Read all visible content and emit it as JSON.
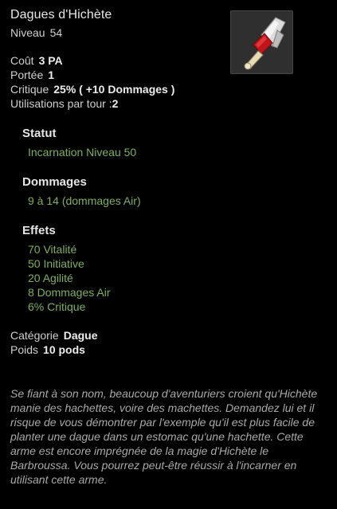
{
  "item": {
    "name": "Dagues d'Hichète",
    "level_label": "Niveau",
    "level_value": "54",
    "icon": "dagger-icon"
  },
  "stats": {
    "cost_label": "Coût",
    "cost_value": "3 PA",
    "range_label": "Portée",
    "range_value": "1",
    "critical_label": "Critique",
    "critical_value": "25% ( +10 Dommages )",
    "uses_label": "Utilisations par tour :",
    "uses_value": "2"
  },
  "sections": {
    "status": {
      "heading": "Statut",
      "lines": [
        "Incarnation Niveau 50"
      ]
    },
    "damage": {
      "heading": "Dommages",
      "lines": [
        "9 à 14 (dommages Air)"
      ]
    },
    "effects": {
      "heading": "Effets",
      "lines": [
        "70 Vitalité",
        "50 Initiative",
        "20 Agilité",
        "8 Dommages Air",
        "6% Critique"
      ]
    }
  },
  "meta": {
    "category_label": "Catégorie",
    "category_value": "Dague",
    "weight_label": "Poids",
    "weight_value": "10 pods"
  },
  "description": "Se fiant à son nom, beaucoup d'aventuriers croient qu'Hichète manie des hachettes, voire des machettes. Demandez lui et il risque de vous démontrer par l'exemple qu'il est plus facile de planter une dague dans un estomac qu'une hachette. Cette arme est encore imprégnée de la magie d'Hichète le Barbroussa. Vous pourrez peut-être réussir à l'incarner en utilisant cette arme.",
  "colors": {
    "background": "#000000",
    "text": "#d9d9d9",
    "effect_green": "#7fb05a",
    "description": "#a9a9a9",
    "thumb_bg": "#2f2f2f"
  }
}
